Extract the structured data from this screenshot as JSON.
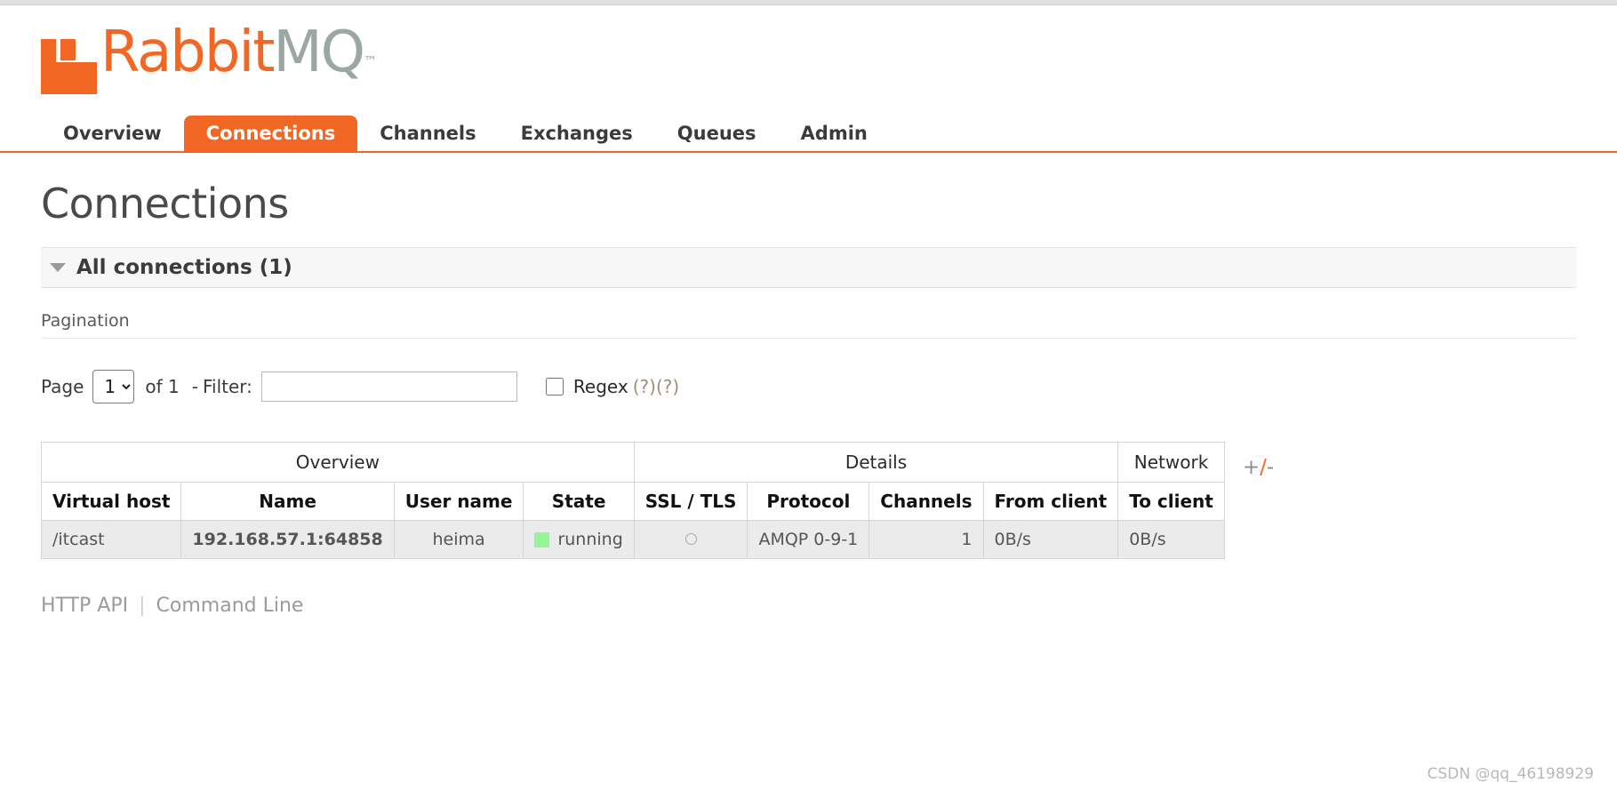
{
  "brand": {
    "name_part1": "Rabbit",
    "name_part2": "MQ",
    "trademark": "™",
    "logo_color": "#f26724",
    "mq_color": "#9aa7a3"
  },
  "nav": {
    "items": [
      {
        "label": "Overview",
        "active": false
      },
      {
        "label": "Connections",
        "active": true
      },
      {
        "label": "Channels",
        "active": false
      },
      {
        "label": "Exchanges",
        "active": false
      },
      {
        "label": "Queues",
        "active": false
      },
      {
        "label": "Admin",
        "active": false
      }
    ],
    "active_color": "#f26724"
  },
  "page": {
    "title": "Connections"
  },
  "section": {
    "label": "All connections (1)",
    "expanded": true
  },
  "pagination": {
    "title": "Pagination",
    "page_label": "Page",
    "page_value": "1",
    "page_options": [
      "1"
    ],
    "of_label": "of 1",
    "dash": "-",
    "filter_label": "Filter:",
    "filter_value": "",
    "filter_placeholder": "",
    "regex_label": "Regex",
    "regex_checked": false,
    "help_1": "(?)",
    "help_2": "(?)"
  },
  "table": {
    "group_headers": [
      {
        "label": "Overview",
        "span": 4
      },
      {
        "label": "Details",
        "span": 4
      },
      {
        "label": "Network",
        "span": 2
      }
    ],
    "columns": [
      "Virtual host",
      "Name",
      "User name",
      "State",
      "SSL / TLS",
      "Protocol",
      "Channels",
      "From client",
      "To client"
    ],
    "rows": [
      {
        "virtual_host": "/itcast",
        "name": "192.168.57.1:64858",
        "user_name": "heima",
        "state": "running",
        "state_color": "#97f599",
        "ssl_tls": "",
        "protocol": "AMQP 0-9-1",
        "channels": "1",
        "from_client": "0B/s",
        "to_client": "0B/s"
      }
    ],
    "toggle_columns": {
      "plus": "+",
      "slash": "/",
      "minus": "-"
    }
  },
  "footer": {
    "http_api": "HTTP API",
    "separator": "|",
    "command_line": "Command Line"
  },
  "watermark": {
    "text": "CSDN @qq_46198929"
  }
}
